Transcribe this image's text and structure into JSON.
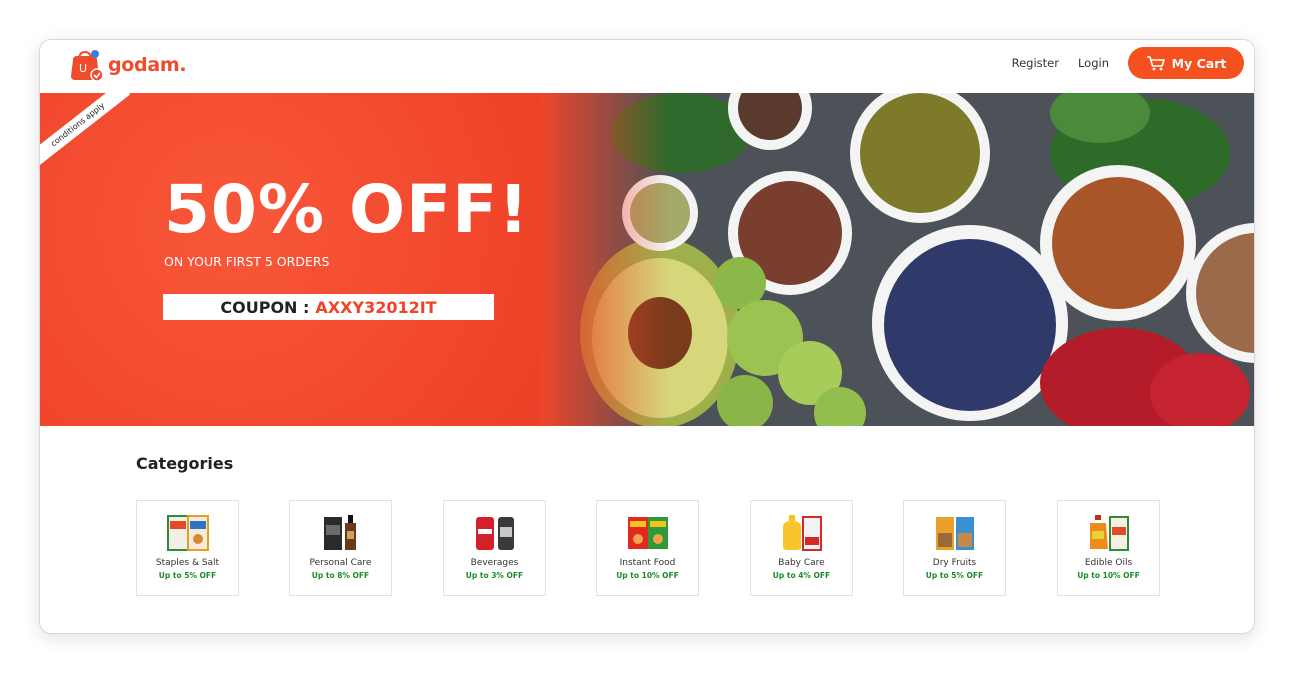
{
  "brand": {
    "name": "godam.",
    "accent": "#f4511e"
  },
  "nav": {
    "register": "Register",
    "login": "Login",
    "cart": "My Cart"
  },
  "banner": {
    "ribbon": "conditions apply",
    "headline": "50% OFF!",
    "subline": "ON YOUR FIRST 5 ORDERS",
    "coupon_label": "COUPON :",
    "coupon_code": "AXXY32012IT"
  },
  "categories": {
    "title": "Categories",
    "items": [
      {
        "name": "Staples & Salt",
        "offer": "Up to 5% OFF",
        "icon": "staples-icon"
      },
      {
        "name": "Personal Care",
        "offer": "Up to 8% OFF",
        "icon": "personal-care-icon"
      },
      {
        "name": "Beverages",
        "offer": "Up to 3% OFF",
        "icon": "beverages-icon"
      },
      {
        "name": "Instant Food",
        "offer": "Up to 10% OFF",
        "icon": "instant-food-icon"
      },
      {
        "name": "Baby Care",
        "offer": "Up to 4% OFF",
        "icon": "baby-care-icon"
      },
      {
        "name": "Dry Fruits",
        "offer": "Up to 5% OFF",
        "icon": "dry-fruits-icon"
      },
      {
        "name": "Edible Oils",
        "offer": "Up to 10% OFF",
        "icon": "edible-oils-icon"
      }
    ]
  }
}
